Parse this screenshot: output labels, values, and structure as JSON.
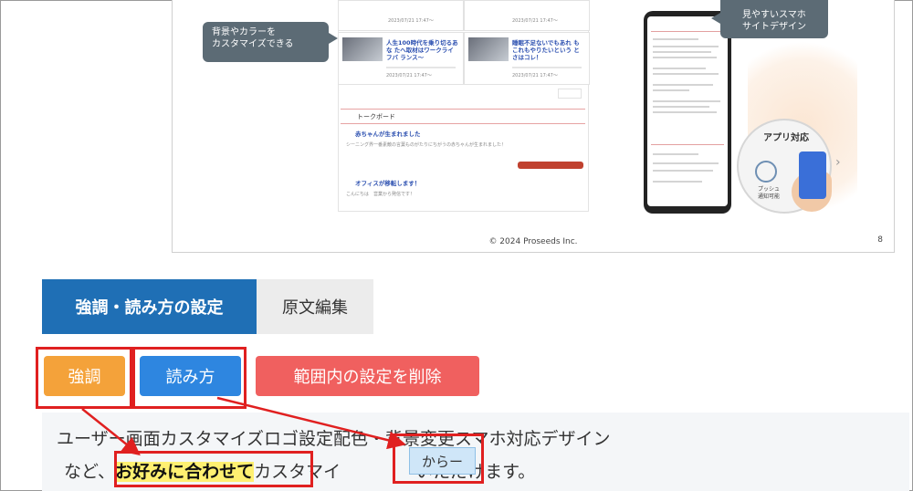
{
  "slide": {
    "bubble_left_line1": "背景やカラーを",
    "bubble_left_line2": "カスタマイズできる",
    "bubble_right_line1": "見やすいスマホ",
    "bubble_right_line2": "サイトデザイン",
    "article1_title": "人生100時代を乗り切るあな たへ取材はワークライフバ ランス～",
    "article2_title": "睡眠不足ないでもあれ もこれもやりたいという とさはコレ！",
    "date1": "2023/07/21 17:47～",
    "date2": "2023/07/21 17:47～",
    "talkboard_title": "トークボード",
    "post1_title": "赤ちゃんが生まれました",
    "post1_body": "シーニング界一番素敵の言葉ものがたりにちがうの赤ちゃんが生まれました！",
    "post2_title": "オフィスが移転します！",
    "post2_body": "こんにちは　営業から発信です！",
    "app_title": "アプリ対応",
    "push_label_line1": "プッシュ",
    "push_label_line2": "通知可能",
    "copyright": "© 2024 Proseeds Inc.",
    "page_number": "8"
  },
  "tabs": {
    "active": "強調・読み方の設定",
    "inactive": "原文編集"
  },
  "buttons": {
    "emphasis": "強調",
    "reading": "読み方",
    "delete_range": "範囲内の設定を削除"
  },
  "editor": {
    "line1": "ユーザー画面カスタマイズロゴ設定配色・背景変更スマホ対応デザイン",
    "line2_prefix": "など、",
    "line2_highlight": "お好みに合わせて",
    "line2_middle": "カスタマイ",
    "line2_suffix": "いただけます。",
    "reading_tooltip": "からー"
  },
  "colors": {
    "tab_active": "#1f6fb5",
    "emphasis_button": "#f4a23a",
    "reading_button": "#2e86e0",
    "delete_button": "#f0605f",
    "annotation_red": "#e02020",
    "highlight_yellow": "#fff071"
  }
}
